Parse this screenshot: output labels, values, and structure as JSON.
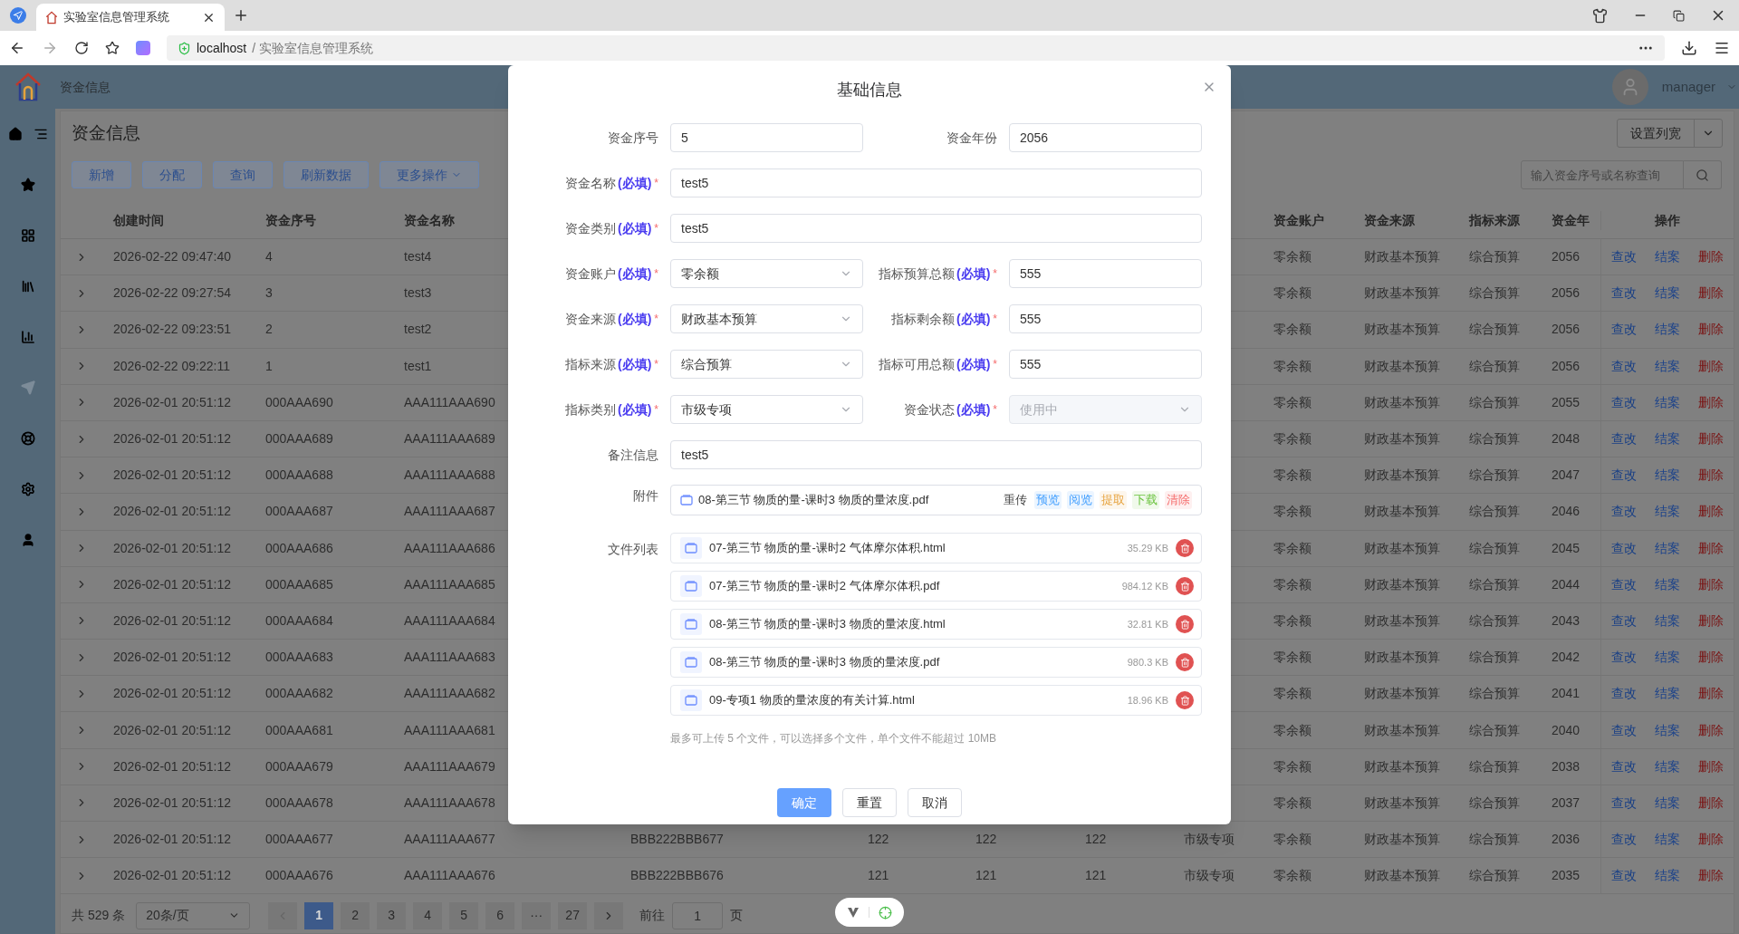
{
  "browser": {
    "tab_title": "实验室信息管理系统",
    "url_host": "localhost",
    "url_path": "/ 实验室信息管理系统"
  },
  "header": {
    "title": "资金信息",
    "user": "manager"
  },
  "sidebar": {
    "items": [
      {
        "kind": "star",
        "disabled": false
      },
      {
        "kind": "grid",
        "disabled": false
      },
      {
        "kind": "library",
        "disabled": false
      },
      {
        "kind": "chart",
        "disabled": false
      },
      {
        "kind": "send",
        "disabled": true
      },
      {
        "kind": "lifebuoy",
        "disabled": false
      },
      {
        "kind": "gear",
        "disabled": false
      },
      {
        "kind": "user",
        "disabled": false
      }
    ]
  },
  "page": {
    "title": "资金信息",
    "toolbar": [
      {
        "label": "新增",
        "dropdown": false
      },
      {
        "label": "分配",
        "dropdown": false
      },
      {
        "label": "查询",
        "dropdown": false
      },
      {
        "label": "刷新数据",
        "dropdown": false
      },
      {
        "label": "更多操作",
        "dropdown": true
      }
    ],
    "column_width_button": "设置列宽",
    "search": {
      "placeholder": "输入资金序号或名称查询"
    }
  },
  "table": {
    "headers": [
      "创建时间",
      "资金序号",
      "资金名称",
      "资金账户",
      "资金来源",
      "指标来源",
      "资金年"
    ],
    "actions_label": "操作",
    "rows": [
      {
        "created": "2026-02-22 09:47:40",
        "serial": "4",
        "name": "test4",
        "account": "零余额",
        "source": "财政基本预算",
        "index_source": "综合预算",
        "year": "2056",
        "actions": [
          {
            "label": "查改",
            "kind": "edit"
          },
          {
            "label": "结案",
            "kind": "close"
          },
          {
            "label": "删除",
            "kind": "delete"
          }
        ]
      },
      {
        "created": "2026-02-22 09:27:54",
        "serial": "3",
        "name": "test3",
        "account": "零余额",
        "source": "财政基本预算",
        "index_source": "综合预算",
        "year": "2056",
        "actions": [
          {
            "label": "查改",
            "kind": "edit"
          },
          {
            "label": "结案",
            "kind": "close"
          },
          {
            "label": "删除",
            "kind": "delete"
          }
        ]
      },
      {
        "created": "2026-02-22 09:23:51",
        "serial": "2",
        "name": "test2",
        "account": "零余额",
        "source": "财政基本预算",
        "index_source": "综合预算",
        "year": "2056",
        "actions": [
          {
            "label": "查改",
            "kind": "edit"
          },
          {
            "label": "结案",
            "kind": "close"
          },
          {
            "label": "删除",
            "kind": "delete"
          }
        ]
      },
      {
        "created": "2026-02-22 09:22:11",
        "serial": "1",
        "name": "test1",
        "account": "零余额",
        "source": "财政基本预算",
        "index_source": "综合预算",
        "year": "2056",
        "actions": [
          {
            "label": "查改",
            "kind": "edit"
          },
          {
            "label": "结案",
            "kind": "close"
          },
          {
            "label": "删除",
            "kind": "delete"
          }
        ]
      },
      {
        "created": "2026-02-01 20:51:12",
        "serial": "000AAA690",
        "name": "AAA111AAA690",
        "account": "零余额",
        "source": "财政基本预算",
        "index_source": "综合预算",
        "year": "2055",
        "actions": [
          {
            "label": "查改",
            "kind": "edit"
          },
          {
            "label": "结案",
            "kind": "close"
          },
          {
            "label": "删除",
            "kind": "delete"
          }
        ]
      },
      {
        "created": "2026-02-01 20:51:12",
        "serial": "000AAA689",
        "name": "AAA111AAA689",
        "account": "零余额",
        "source": "财政基本预算",
        "index_source": "综合预算",
        "year": "2048",
        "actions": [
          {
            "label": "查改",
            "kind": "edit"
          },
          {
            "label": "结案",
            "kind": "close"
          },
          {
            "label": "删除",
            "kind": "delete"
          }
        ]
      },
      {
        "created": "2026-02-01 20:51:12",
        "serial": "000AAA688",
        "name": "AAA111AAA688",
        "account": "零余额",
        "source": "财政基本预算",
        "index_source": "综合预算",
        "year": "2047",
        "actions": [
          {
            "label": "查改",
            "kind": "edit"
          },
          {
            "label": "结案",
            "kind": "close"
          },
          {
            "label": "删除",
            "kind": "delete"
          }
        ]
      },
      {
        "created": "2026-02-01 20:51:12",
        "serial": "000AAA687",
        "name": "AAA111AAA687",
        "account": "零余额",
        "source": "财政基本预算",
        "index_source": "综合预算",
        "year": "2046",
        "actions": [
          {
            "label": "查改",
            "kind": "edit"
          },
          {
            "label": "结案",
            "kind": "close"
          },
          {
            "label": "删除",
            "kind": "delete"
          }
        ]
      },
      {
        "created": "2026-02-01 20:51:12",
        "serial": "000AAA686",
        "name": "AAA111AAA686",
        "account": "零余额",
        "source": "财政基本预算",
        "index_source": "综合预算",
        "year": "2045",
        "actions": [
          {
            "label": "查改",
            "kind": "edit"
          },
          {
            "label": "结案",
            "kind": "close"
          },
          {
            "label": "删除",
            "kind": "delete"
          }
        ]
      },
      {
        "created": "2026-02-01 20:51:12",
        "serial": "000AAA685",
        "name": "AAA111AAA685",
        "account": "零余额",
        "source": "财政基本预算",
        "index_source": "综合预算",
        "year": "2044",
        "actions": [
          {
            "label": "查改",
            "kind": "edit"
          },
          {
            "label": "结案",
            "kind": "close"
          },
          {
            "label": "删除",
            "kind": "delete"
          }
        ]
      },
      {
        "created": "2026-02-01 20:51:12",
        "serial": "000AAA684",
        "name": "AAA111AAA684",
        "account": "零余额",
        "source": "财政基本预算",
        "index_source": "综合预算",
        "year": "2043",
        "actions": [
          {
            "label": "查改",
            "kind": "edit"
          },
          {
            "label": "结案",
            "kind": "close"
          },
          {
            "label": "删除",
            "kind": "delete"
          }
        ]
      },
      {
        "created": "2026-02-01 20:51:12",
        "serial": "000AAA683",
        "name": "AAA111AAA683",
        "account": "零余额",
        "source": "财政基本预算",
        "index_source": "综合预算",
        "year": "2042",
        "actions": [
          {
            "label": "查改",
            "kind": "edit"
          },
          {
            "label": "结案",
            "kind": "close"
          },
          {
            "label": "删除",
            "kind": "delete"
          }
        ]
      },
      {
        "created": "2026-02-01 20:51:12",
        "serial": "000AAA682",
        "name": "AAA111AAA682",
        "account": "零余额",
        "source": "财政基本预算",
        "index_source": "综合预算",
        "year": "2041",
        "actions": [
          {
            "label": "查改",
            "kind": "edit"
          },
          {
            "label": "结案",
            "kind": "close"
          },
          {
            "label": "删除",
            "kind": "delete"
          }
        ]
      },
      {
        "created": "2026-02-01 20:51:12",
        "serial": "000AAA681",
        "name": "AAA111AAA681",
        "account": "零余额",
        "source": "财政基本预算",
        "index_source": "综合预算",
        "year": "2040",
        "actions": [
          {
            "label": "查改",
            "kind": "edit"
          },
          {
            "label": "结案",
            "kind": "close"
          },
          {
            "label": "删除",
            "kind": "delete"
          }
        ]
      },
      {
        "created": "2026-02-01 20:51:12",
        "serial": "000AAA679",
        "name": "AAA111AAA679",
        "account": "零余额",
        "source": "财政基本预算",
        "index_source": "综合预算",
        "year": "2038",
        "actions": [
          {
            "label": "查改",
            "kind": "edit"
          },
          {
            "label": "结案",
            "kind": "close"
          },
          {
            "label": "删除",
            "kind": "delete"
          }
        ]
      },
      {
        "created": "2026-02-01 20:51:12",
        "serial": "000AAA678",
        "name": "AAA111AAA678",
        "account": "零余额",
        "source": "财政基本预算",
        "index_source": "综合预算",
        "year": "2037",
        "actions": [
          {
            "label": "查改",
            "kind": "edit"
          },
          {
            "label": "结案",
            "kind": "close"
          },
          {
            "label": "删除",
            "kind": "delete"
          }
        ]
      },
      {
        "created": "2026-02-01 20:51:12",
        "serial": "000AAA677",
        "name": "AAA111AAA677",
        "column_4": "BBB222BBB677",
        "column_5": "122",
        "column_6": "122",
        "column_7": "122",
        "column_8": "市级专项",
        "account": "零余额",
        "source": "财政基本预算",
        "index_source": "综合预算",
        "year": "2036",
        "actions": [
          {
            "label": "查改",
            "kind": "edit"
          },
          {
            "label": "结案",
            "kind": "close"
          },
          {
            "label": "删除",
            "kind": "delete"
          }
        ]
      },
      {
        "created": "2026-02-01 20:51:12",
        "serial": "000AAA676",
        "name": "AAA111AAA676",
        "column_4": "BBB222BBB676",
        "column_5": "121",
        "column_6": "121",
        "column_7": "121",
        "column_8": "市级专项",
        "account": "零余额",
        "source": "财政基本预算",
        "index_source": "综合预算",
        "year": "2035",
        "actions": [
          {
            "label": "查改",
            "kind": "edit"
          },
          {
            "label": "结案",
            "kind": "close"
          },
          {
            "label": "删除",
            "kind": "delete"
          }
        ]
      }
    ]
  },
  "pagination": {
    "total": "共 529 条",
    "page_size": "20条/页",
    "pages": [
      {
        "label": "1",
        "selected": true
      },
      {
        "label": "2",
        "selected": false
      },
      {
        "label": "3",
        "selected": false
      },
      {
        "label": "4",
        "selected": false
      },
      {
        "label": "5",
        "selected": false
      },
      {
        "label": "6",
        "selected": false
      },
      {
        "label": "···",
        "selected": false
      },
      {
        "label": "27",
        "selected": false
      }
    ],
    "goto_prefix": "前往",
    "goto_value": "1",
    "goto_suffix": "页"
  },
  "modal": {
    "title": "基础信息",
    "rows": [
      [
        {
          "label": "资金序号",
          "kind": "text",
          "value": "5",
          "disabled": false
        },
        {
          "label": "资金年份",
          "kind": "text",
          "value": "2056",
          "disabled": false
        }
      ],
      [
        {
          "label": "资金名称",
          "note": "(必填)",
          "mark": "*",
          "kind": "text",
          "value": "test5",
          "disabled": false
        }
      ],
      [
        {
          "label": "资金类别",
          "note": "(必填)",
          "mark": "*",
          "kind": "text",
          "value": "test5",
          "disabled": false
        }
      ],
      [
        {
          "label": "资金账户",
          "note": "(必填)",
          "mark": "*",
          "kind": "select",
          "value": "零余额",
          "disabled": false
        },
        {
          "label": "指标预算总额",
          "note": "(必填)",
          "mark": "*",
          "kind": "text",
          "value": "555",
          "disabled": false
        }
      ],
      [
        {
          "label": "资金来源",
          "note": "(必填)",
          "mark": "*",
          "kind": "select",
          "value": "财政基本预算",
          "disabled": false
        },
        {
          "label": "指标剩余额",
          "note": "(必填)",
          "mark": "*",
          "kind": "text",
          "value": "555",
          "disabled": false
        }
      ],
      [
        {
          "label": "指标来源",
          "note": "(必填)",
          "mark": "*",
          "kind": "select",
          "value": "综合预算",
          "disabled": false
        },
        {
          "label": "指标可用总额",
          "note": "(必填)",
          "mark": "*",
          "kind": "text",
          "value": "555",
          "disabled": false
        }
      ],
      [
        {
          "label": "指标类别",
          "note": "(必填)",
          "mark": "*",
          "kind": "select",
          "value": "市级专项",
          "disabled": false
        },
        {
          "label": "资金状态",
          "note": "(必填)",
          "mark": "*",
          "kind": "select",
          "value": "使用中",
          "disabled": true
        }
      ],
      [
        {
          "label": "备注信息",
          "kind": "text",
          "value": "test5",
          "disabled": false
        }
      ]
    ],
    "attachment": {
      "label": "附件",
      "file": "08-第三节 物质的量-课时3 物质的量浓度.pdf",
      "actions": [
        {
          "label": "重传",
          "kind": "plain"
        },
        {
          "label": "预览",
          "kind": "blue"
        },
        {
          "label": "阅览",
          "kind": "blue"
        },
        {
          "label": "提取",
          "kind": "orange"
        },
        {
          "label": "下载",
          "kind": "green"
        },
        {
          "label": "清除",
          "kind": "red"
        }
      ]
    },
    "file_list": {
      "label": "文件列表",
      "files": [
        {
          "name": "07-第三节 物质的量-课时2 气体摩尔体积.html",
          "size": "35.29 KB"
        },
        {
          "name": "07-第三节 物质的量-课时2 气体摩尔体积.pdf",
          "size": "984.12 KB"
        },
        {
          "name": "08-第三节 物质的量-课时3 物质的量浓度.html",
          "size": "32.81 KB"
        },
        {
          "name": "08-第三节 物质的量-课时3 物质的量浓度.pdf",
          "size": "980.3 KB"
        },
        {
          "name": "09-专项1 物质的量浓度的有关计算.html",
          "size": "18.96 KB"
        }
      ]
    },
    "hint": "最多可上传 5 个文件，可以选择多个文件，单个文件不能超过 10MB",
    "buttons": [
      {
        "label": "确定",
        "kind": "primary"
      },
      {
        "label": "重置",
        "kind": "default"
      },
      {
        "label": "取消",
        "kind": "default"
      }
    ]
  }
}
